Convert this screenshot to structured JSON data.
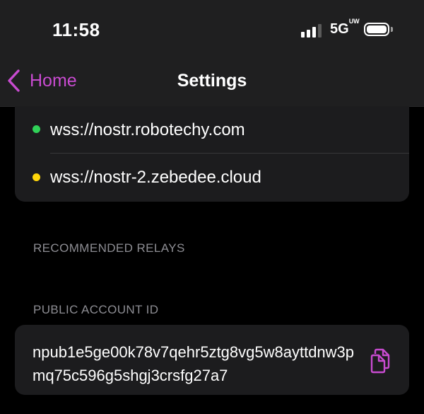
{
  "status_bar": {
    "time": "11:58",
    "network": "5G",
    "network_suffix": "UW"
  },
  "nav": {
    "back_label": "Home",
    "title": "Settings"
  },
  "relays": [
    {
      "url": "wss://nostr.robotechy.com",
      "status_color": "#30d158"
    },
    {
      "url": "wss://nostr-2.zebedee.cloud",
      "status_color": "#ffd60a"
    }
  ],
  "sections": {
    "recommended_relays": "RECOMMENDED RELAYS",
    "public_account_id": "PUBLIC ACCOUNT ID"
  },
  "account": {
    "public_id": "npub1e5ge00k78v7qehr5ztg8vg5w8ayttdnw3pmq75c596g5shgj3crsfg27a7"
  },
  "colors": {
    "accent": "#c84bd0",
    "background": "#000000",
    "card": "#1c1c1e",
    "header": "#1f1f20",
    "secondary_text": "#8d8d93"
  },
  "icons": {
    "back": "chevron-left-icon",
    "copy": "copy-icon"
  }
}
